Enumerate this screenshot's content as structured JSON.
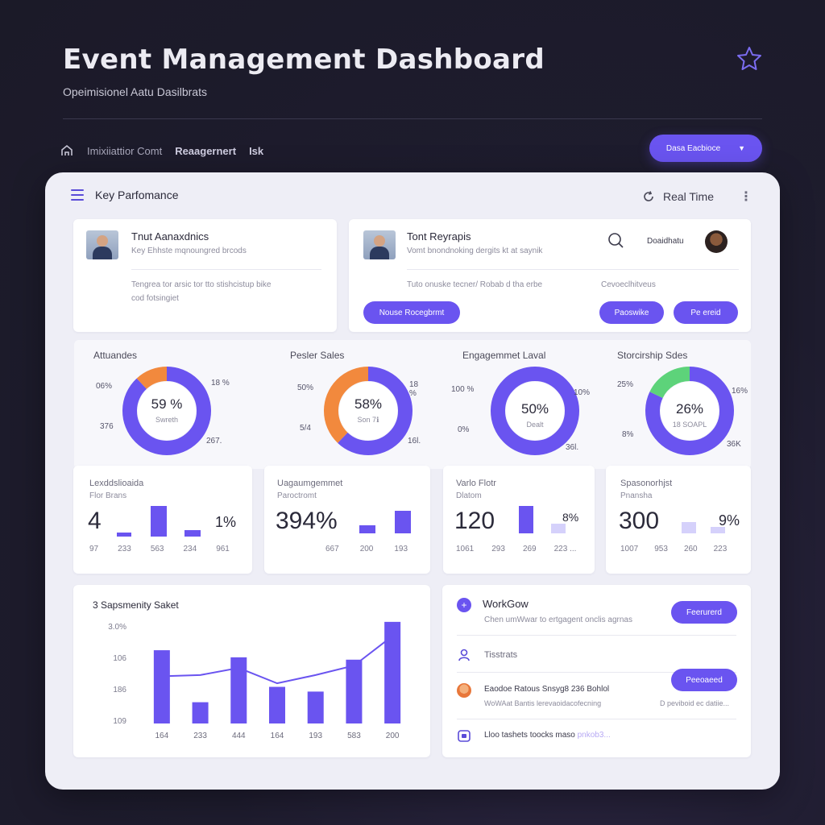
{
  "header": {
    "title": "Event Management Dashboard",
    "subtitle": "Opeimisionel Aatu Dasilbrats",
    "breadcrumb": [
      "Imixiiattior Comt",
      "Reaagernert",
      "Isk"
    ],
    "dropdown_label": "Dasa Eacbioce"
  },
  "panel": {
    "title": "Key Parfomance",
    "right_label": "Real Time"
  },
  "top_cards": [
    {
      "title": "Tnut Aanaxdnics",
      "sub": "Key Ehhste mqnoungred brcods",
      "body": "Tengrea tor arsic tor tto stishcistup bike",
      "body2": "cod fotsingiet"
    },
    {
      "title": "Tont Reyrapis",
      "sub": "Vomt bnondnoking dergits kt at saynik",
      "body": "Tuto onuske tecner/ Robab d tha erbe",
      "body2": "Cevoeclhitveus",
      "right_label": "Doaidhatu",
      "buttons": [
        "Nouse Rocegbrmt",
        "Paoswike",
        "Pe ereid"
      ]
    }
  ],
  "donuts": [
    {
      "label": "Attuandes",
      "value": "59 %",
      "sub": "Swreth",
      "left_top": "06%",
      "right_top": "18 %",
      "left_bottom": "376",
      "right_bottom": "267.",
      "primary_pct": 0.88,
      "accent_pct": 0.12,
      "accent": "#f2893d"
    },
    {
      "label": "Pesler Sales",
      "value": "58%",
      "sub": "Son 7ℹ",
      "left_top": "50%",
      "right_top": "18 %",
      "left_bottom": "5/4",
      "right_bottom": "16l.",
      "primary_pct": 0.62,
      "accent_pct": 0.38,
      "accent": "#f2893d"
    },
    {
      "label": "Engagemmet Laval",
      "value": "50%",
      "sub": "Dealt",
      "left_top": "100 %",
      "right_top": "10%",
      "left_bottom": "0%",
      "right_bottom": "36l.",
      "primary_pct": 1.0,
      "accent_pct": 0.0,
      "accent": "#6a54f0"
    },
    {
      "label": "Storcirship Sdes",
      "value": "26%",
      "sub": "18 SOAPL",
      "left_top": "25%",
      "right_top": "16%",
      "left_bottom": "8%",
      "right_bottom": "36K",
      "primary_pct": 0.82,
      "accent_pct": 0.18,
      "accent": "#5dd37a"
    }
  ],
  "stat_cards": [
    {
      "title": "Lexddslioaida",
      "sub": "Flor Brans",
      "big": "4",
      "pct": "1%",
      "axis": [
        "97",
        "233",
        "563",
        "234",
        "961"
      ],
      "bars": [
        {
          "h": 0.1,
          "light": false
        },
        {
          "h": 1.0,
          "light": false
        },
        {
          "h": 0.2,
          "light": false
        }
      ]
    },
    {
      "title": "Uagaumgemmet",
      "sub": "Paroctromt",
      "big": "394%",
      "pct": "",
      "axis": [
        "667",
        "200",
        "193"
      ],
      "bars": [
        {
          "h": 0.35,
          "light": false
        },
        {
          "h": 0.95,
          "light": false
        }
      ]
    },
    {
      "title": "Varlo Flotr",
      "sub": "Dlatom",
      "big": "120",
      "pct": "8%",
      "axis": [
        "1061",
        "293",
        "269",
        "223 ..."
      ],
      "bars": [
        {
          "h": 1.0,
          "light": false
        },
        {
          "h": 0.35,
          "light": true
        }
      ]
    },
    {
      "title": "Spasonorhjst",
      "sub": "Pnansha",
      "big": "300",
      "pct": "9%",
      "axis": [
        "1007",
        "953",
        "260",
        "223"
      ],
      "bars": [
        {
          "h": 0.5,
          "light": true
        },
        {
          "h": 0.3,
          "light": true
        }
      ]
    }
  ],
  "chart_data": {
    "type": "bar",
    "title": "3 Sapsmenity Saket",
    "categories": [
      "164",
      "233",
      "444",
      "164",
      "193",
      "583",
      "200"
    ],
    "values": [
      310,
      90,
      280,
      155,
      135,
      270,
      430
    ],
    "line": [
      200,
      205,
      235,
      170,
      205,
      245,
      370
    ],
    "yticks": [
      "3.0%",
      "106",
      "186",
      "109"
    ],
    "ylim": [
      0,
      450
    ]
  },
  "workflow": {
    "title": "WorkGow",
    "desc": "Chen umWwar to ertgagent onclis agrnas",
    "button1": "Feerurerd",
    "item2": "Tisstrats",
    "item3_title": "Eaodoe Ratous Snsyg8 236 Bohlol",
    "item3_sub": "WoWAat Bantis lerevaoidacofecning",
    "item3_right": "D peviboid ec datiie...",
    "button2": "Peeoaeed",
    "item4": "Lloo tashets toocks maso",
    "item4_strong": "pnkob3..."
  }
}
